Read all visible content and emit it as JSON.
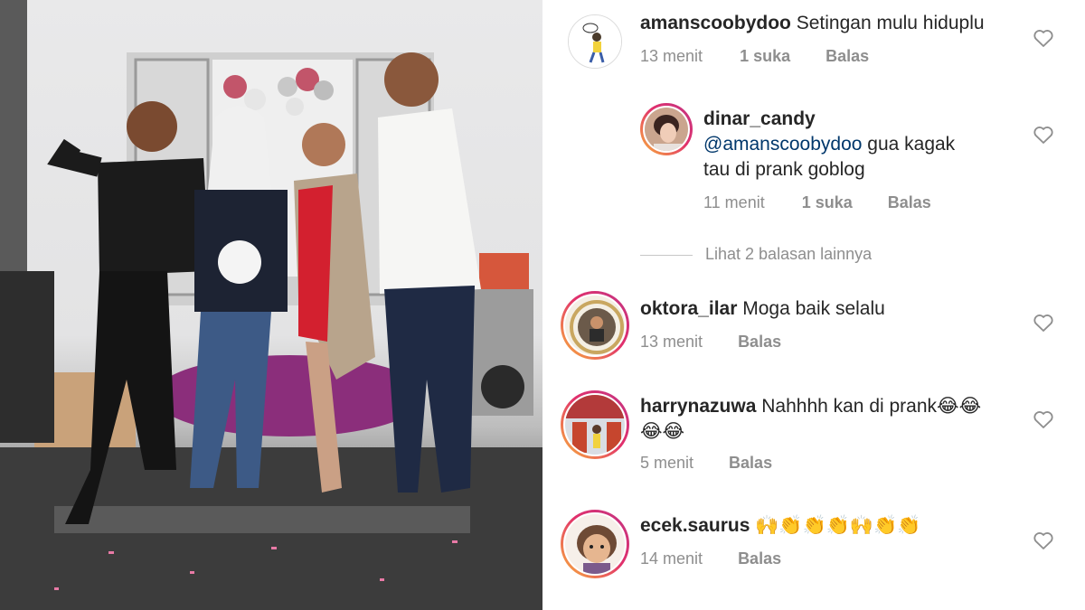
{
  "comments": [
    {
      "username": "amanscoobydoo",
      "text": "Setingan mulu hiduplu",
      "time": "13 menit",
      "likes": "1 suka",
      "reply": "Balas"
    },
    {
      "username": "dinar_candy",
      "mention": "@amanscoobydoo",
      "text_line1_rest": " gua kagak",
      "text_line2": "tau di prank goblog",
      "time": "11 menit",
      "likes": "1 suka",
      "reply": "Balas"
    },
    {
      "view_more": "Lihat 2 balasan lainnya"
    },
    {
      "username": "oktora_ilar",
      "text": "Moga baik selalu",
      "time": "13 menit",
      "reply": "Balas"
    },
    {
      "username": "harrynazuwa",
      "text": "Nahhhh kan di prank😂😂",
      "text_line2": "😂😂",
      "time": "5 menit",
      "reply": "Balas"
    },
    {
      "username": "ecek.saurus",
      "text": "🙌👏👏👏🙌👏👏",
      "time": "14 menit",
      "reply": "Balas"
    }
  ],
  "icons": {
    "like": "heart-outline-icon"
  },
  "colors": {
    "username": "#262626",
    "mention": "#00376b",
    "meta": "#8e8e8e",
    "ring_start": "#f9b43a",
    "ring_end": "#c13584"
  }
}
